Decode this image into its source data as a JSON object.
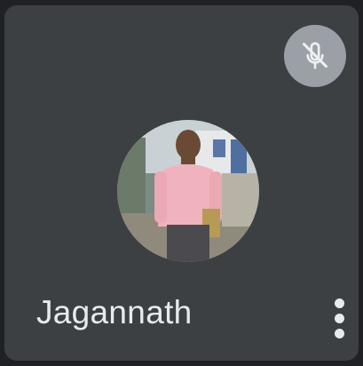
{
  "tile": {
    "participant_name": "Jagannath",
    "status_icon": "mic-off-icon",
    "menu_icon": "more-vert-icon",
    "colors": {
      "tile_background": "#3c4043",
      "badge_background": "#9aa0a6",
      "text": "#e8eaed"
    }
  }
}
